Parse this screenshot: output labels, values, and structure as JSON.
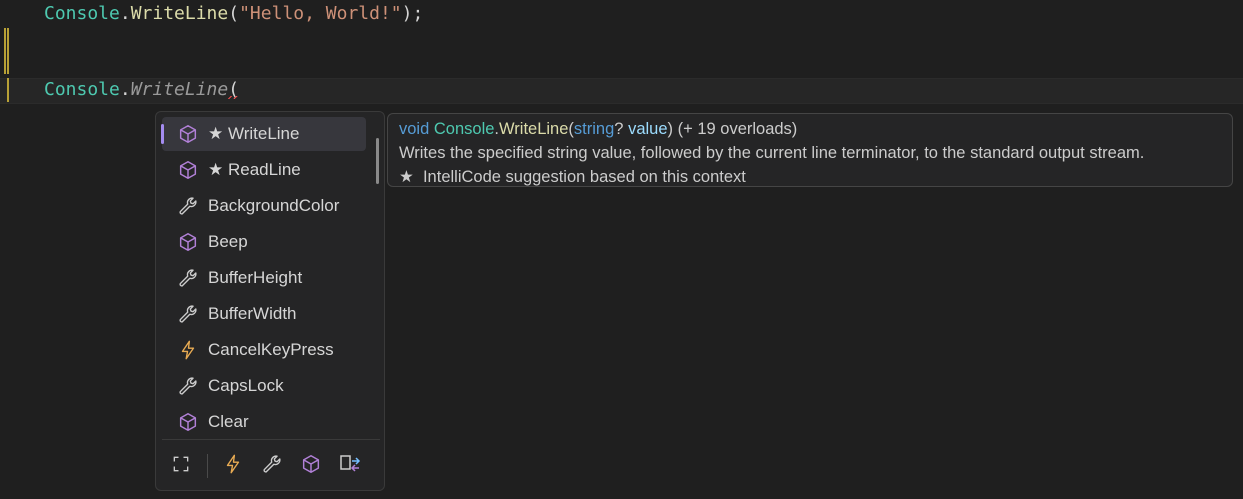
{
  "code": {
    "line1": {
      "type": "Console",
      "dot": ".",
      "method": "WriteLine",
      "open": "(",
      "string": "\"Hello, World!\"",
      "close": ");"
    },
    "line3": {
      "type": "Console",
      "dot": ".",
      "method_ghost": "WriteLine",
      "open": "("
    }
  },
  "completion": {
    "items": [
      {
        "label": "★ WriteLine",
        "icon": "method-cube-icon",
        "selected": true
      },
      {
        "label": "★ ReadLine",
        "icon": "method-cube-icon"
      },
      {
        "label": "BackgroundColor",
        "icon": "wrench-icon"
      },
      {
        "label": "Beep",
        "icon": "method-cube-icon"
      },
      {
        "label": "BufferHeight",
        "icon": "wrench-icon"
      },
      {
        "label": "BufferWidth",
        "icon": "wrench-icon"
      },
      {
        "label": "CancelKeyPress",
        "icon": "lightning-icon"
      },
      {
        "label": "CapsLock",
        "icon": "wrench-icon"
      },
      {
        "label": "Clear",
        "icon": "method-cube-icon"
      }
    ],
    "filters": [
      "expand-icon",
      "lightning-icon",
      "wrench-icon",
      "method-cube-icon",
      "extension-method-icon"
    ]
  },
  "tooltip": {
    "signature": {
      "kw": "void",
      "type": "Console",
      "dot": ".",
      "method": "WriteLine",
      "open": "(",
      "param_type": "string",
      "nullable": "?",
      "param": "value",
      "close": ")",
      "overloads": "(+ 19 overloads)"
    },
    "description": "Writes the specified string value, followed by the current line terminator, to the standard output stream.",
    "star": "★",
    "intellicode": "IntelliCode suggestion based on this context"
  },
  "colors": {
    "accent": "#a48cf0",
    "method_icon": "#b180d7",
    "event_icon": "#e8ab53",
    "type": "#4ec9b0",
    "method": "#dcdcaa",
    "string": "#ce9178",
    "keyword": "#569cd6",
    "parameter": "#9cdcfe"
  }
}
